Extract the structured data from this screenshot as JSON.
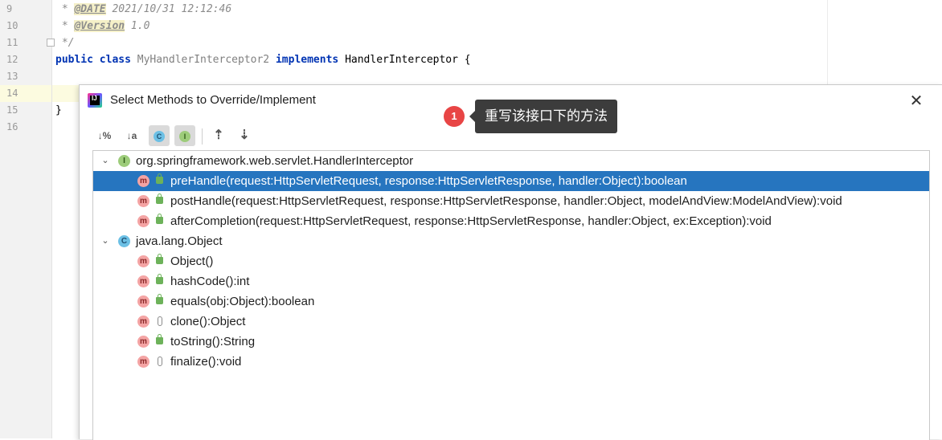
{
  "editor": {
    "lines": [
      {
        "num": "9",
        "text": " * ",
        "tag": "@DATE",
        "rest": " 2021/10/31 12:12:46"
      },
      {
        "num": "10",
        "text": " * ",
        "tag": "@Version",
        "rest": " 1.0"
      },
      {
        "num": "11",
        "text": " */"
      },
      {
        "num": "12",
        "kw1": "public",
        "kw2": "class",
        "cls": "MyHandlerInterceptor2",
        "kw3": "implements",
        "iface": "HandlerInterceptor",
        "brace": "{"
      },
      {
        "num": "13"
      },
      {
        "num": "14"
      },
      {
        "num": "15",
        "brace": "}"
      },
      {
        "num": "16"
      }
    ]
  },
  "dialog": {
    "title": "Select Methods to Override/Implement",
    "close_glyph": "✕",
    "annotation": {
      "badge": "1",
      "tooltip": "重写该接口下的方法"
    },
    "toolbar": {
      "sort_visibility": "↓%",
      "sort_alpha": "↓a",
      "show_classes": "C",
      "show_interfaces": "I",
      "expand_all": "⇡",
      "collapse_all": "⇣"
    },
    "groups": [
      {
        "name": "org.springframework.web.servlet.HandlerInterceptor",
        "kind": "I",
        "methods": [
          {
            "label": "preHandle(request:HttpServletRequest, response:HttpServletResponse, handler:Object):boolean",
            "vis": "public",
            "selected": true
          },
          {
            "label": "postHandle(request:HttpServletRequest, response:HttpServletResponse, handler:Object, modelAndView:ModelAndView):void",
            "vis": "public"
          },
          {
            "label": "afterCompletion(request:HttpServletRequest, response:HttpServletResponse, handler:Object, ex:Exception):void",
            "vis": "public"
          }
        ]
      },
      {
        "name": "java.lang.Object",
        "kind": "C",
        "methods": [
          {
            "label": "Object()",
            "vis": "public"
          },
          {
            "label": "hashCode():int",
            "vis": "public"
          },
          {
            "label": "equals(obj:Object):boolean",
            "vis": "public"
          },
          {
            "label": "clone():Object",
            "vis": "protected"
          },
          {
            "label": "toString():String",
            "vis": "public"
          },
          {
            "label": "finalize():void",
            "vis": "protected"
          }
        ]
      }
    ],
    "method_icon": "m",
    "expanded_glyph": "⌄"
  },
  "colors": {
    "selection": "#2675bf",
    "badge": "#e84545",
    "tooltip": "#3c3c3c"
  }
}
